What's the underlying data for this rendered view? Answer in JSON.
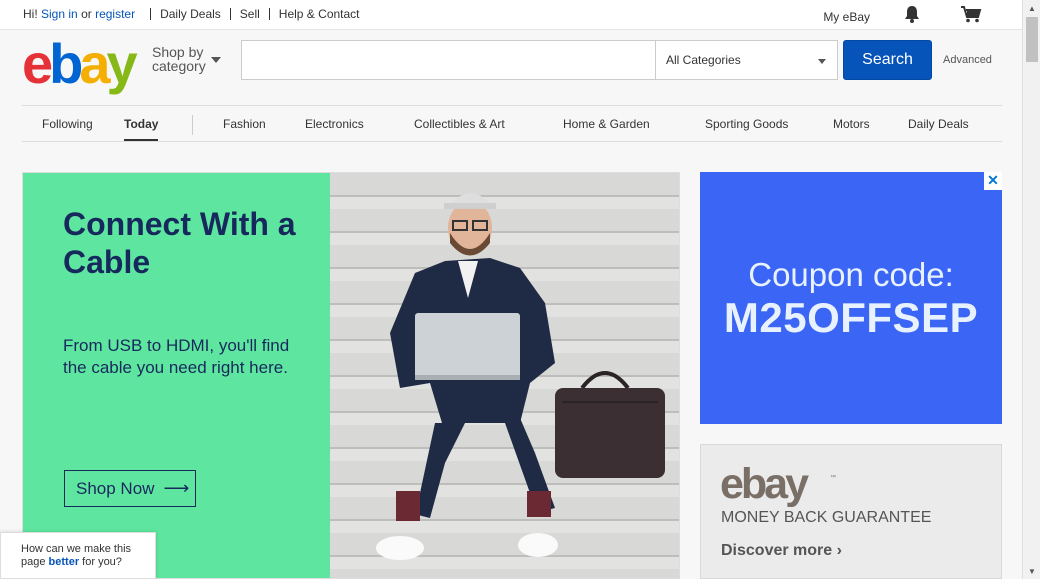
{
  "topbar": {
    "greeting": "Hi!",
    "sign_in": "Sign in",
    "or": "or",
    "register": "register",
    "daily_deals": "Daily Deals",
    "sell": "Sell",
    "help": "Help & Contact",
    "my_ebay": "My eBay",
    "bell_icon": "bell-icon",
    "cart_icon": "cart-icon"
  },
  "header": {
    "logo": {
      "e": "e",
      "b": "b",
      "a": "a",
      "y": "y"
    },
    "shop_by_line1": "Shop by",
    "shop_by_line2": "category",
    "search_placeholder": "",
    "category_value": "All Categories",
    "search_button": "Search",
    "advanced": "Advanced"
  },
  "nav": {
    "items": [
      "Following",
      "Today",
      "Fashion",
      "Electronics",
      "Collectibles & Art",
      "Home & Garden",
      "Sporting Goods",
      "Motors",
      "Daily Deals"
    ],
    "active": "Today"
  },
  "hero": {
    "title": "Connect With a Cable",
    "text": "From USB to HDMI, you'll find the cable you need right here.",
    "button": "Shop Now",
    "bg_color": "#5ee6a0",
    "text_color": "#17295c"
  },
  "coupon_ad": {
    "line1": "Coupon code:",
    "line2": "M25OFFSEP",
    "close": "✕",
    "bg_color": "#3a65f5"
  },
  "money_back": {
    "logo": "ebay",
    "tm": "™",
    "guarantee": "MONEY BACK GUARANTEE",
    "discover": "Discover more"
  },
  "feedback": {
    "line1": "How can we make this",
    "line2_pre": "page",
    "line2_link": "better",
    "line2_post": "for you?"
  }
}
